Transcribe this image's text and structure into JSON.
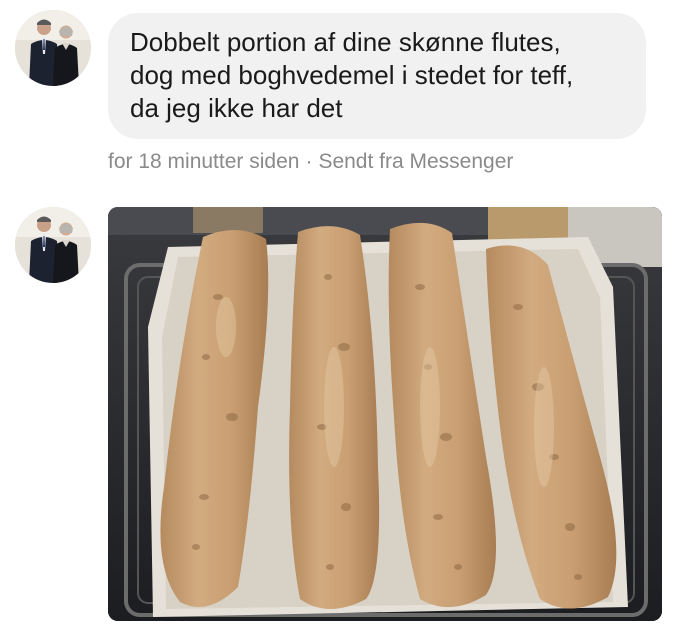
{
  "messages": [
    {
      "sender_avatar": "person-avatar",
      "type": "text",
      "lines": [
        "Dobbelt portion af dine skønne flutes,",
        "dog med boghvedemel i stedet for teff,",
        "da jeg ikke har det"
      ]
    },
    {
      "sender_avatar": "person-avatar",
      "type": "image",
      "image_subject": "four baked baguettes on parchment paper on a baking rack"
    }
  ],
  "meta": {
    "time": "for 18 minutter siden",
    "separator": "·",
    "source": "Sendt fra Messenger"
  },
  "colors": {
    "bubble": "#f1f1f1",
    "text": "#1a1a1a",
    "meta_text": "#8a8a8a"
  }
}
